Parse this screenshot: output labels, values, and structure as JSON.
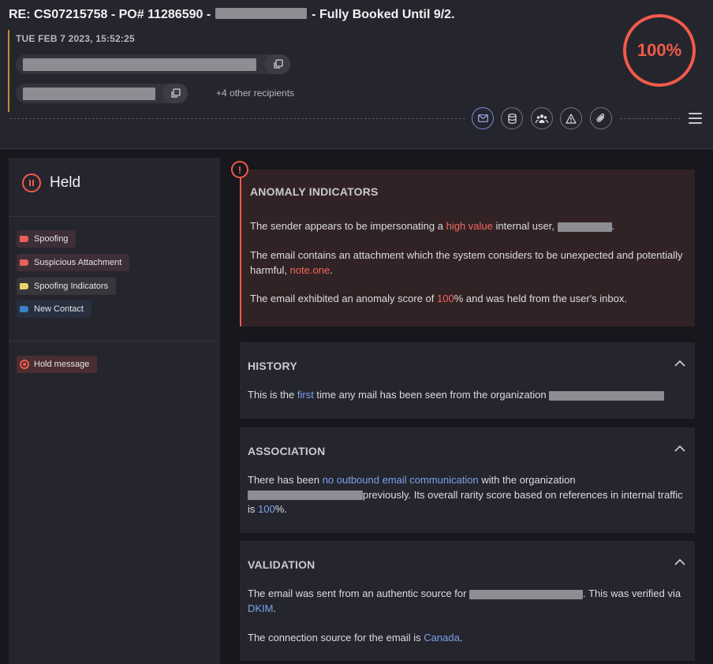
{
  "header": {
    "subject_prefix": "RE: CS07215758 - PO# 11286590 -",
    "subject_suffix": "- Fully Booked Until 9/2.",
    "date": "TUE FEB 7 2023, 15:52:25",
    "recipients_more": "+4 other recipients",
    "score": "100%",
    "toolbar_icons": [
      "envelope-icon",
      "database-icon",
      "users-icon",
      "warning-icon",
      "paperclip-icon"
    ]
  },
  "sidebar": {
    "status": "Held",
    "tags": [
      {
        "label": "Spoofing",
        "color": "#e8625a"
      },
      {
        "label": "Suspicious Attachment",
        "color": "#e8625a"
      },
      {
        "label": "Spoofing Indicators",
        "color": "#e6d46a"
      },
      {
        "label": "New Contact",
        "color": "#3d7fc4"
      }
    ],
    "hold_message": "Hold message"
  },
  "anomaly": {
    "title": "ANOMALY INDICATORS",
    "p1_a": "The sender appears to be impersonating a ",
    "p1_hl": "high value",
    "p1_b": " internal user, ",
    "p1_c": ".",
    "p2_a": "The email contains an attachment which the system considers to be unexpected and potentially harmful, ",
    "p2_hl": "note.one",
    "p2_b": ".",
    "p3_a": "The email exhibited an anomaly score of ",
    "p3_hl": "100",
    "p3_b": "% and was held from the user's inbox."
  },
  "history": {
    "title": "HISTORY",
    "a": "This is the ",
    "hl": "first",
    "b": " time any mail has been seen from the organization "
  },
  "association": {
    "title": "ASSOCIATION",
    "a": "There has been ",
    "hl": "no outbound email communication",
    "b": " with the organization",
    "c": "previously. Its overall rarity score based on references in internal traffic is ",
    "hl2": "100",
    "d": "%."
  },
  "validation": {
    "title": "VALIDATION",
    "a": "The email was sent from an authentic source for ",
    "b": ". This was verified via ",
    "hl": "DKIM",
    "c": ".",
    "d": "The connection source for the email is ",
    "hl2": "Canada",
    "e": "."
  },
  "colors": {
    "accent_red": "#f15a4a",
    "link_blue": "#7aa2ea"
  }
}
